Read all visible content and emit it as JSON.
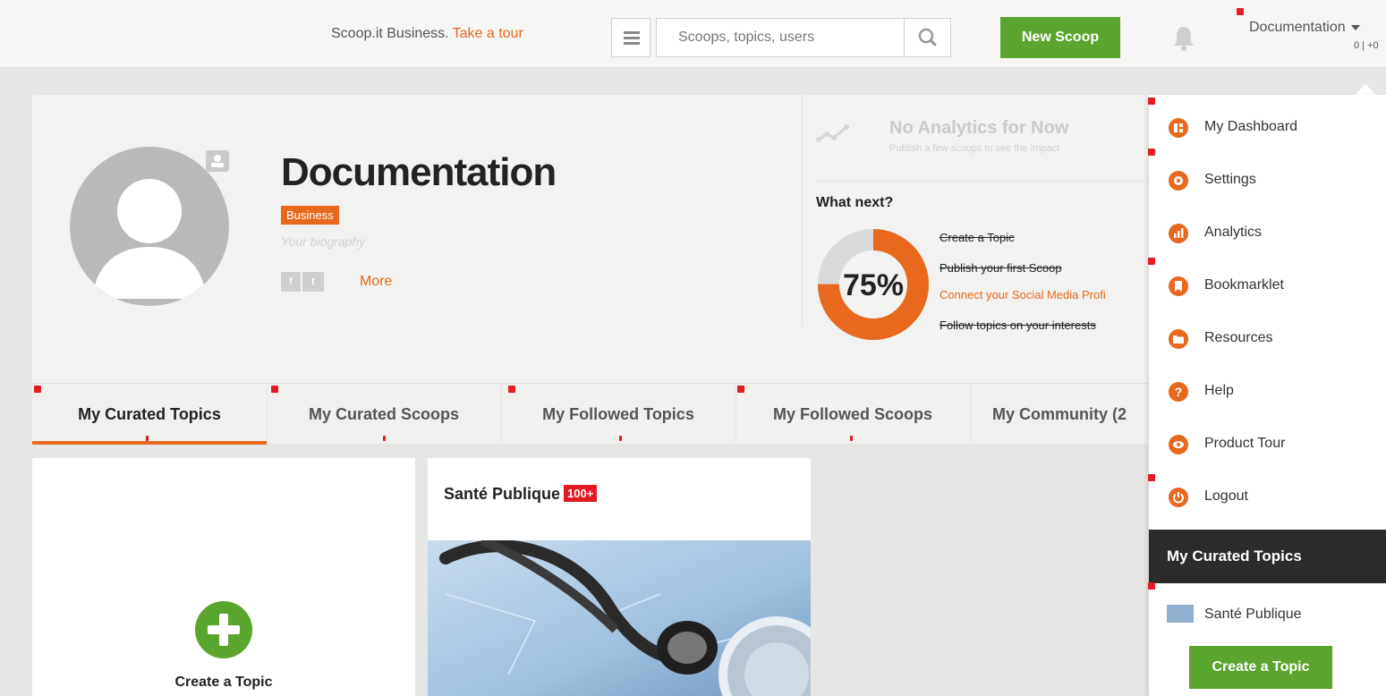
{
  "topbar": {
    "promo_text": "Scoop.it Business.",
    "tour_link": "Take a tour",
    "search_placeholder": "Scoops, topics, users",
    "new_scoop": "New Scoop",
    "account_name": "Documentation",
    "account_count": "0 | +0"
  },
  "profile": {
    "name": "Documentation",
    "badge": "Business",
    "bio_placeholder": "Your biography",
    "social": [
      "f",
      "t"
    ],
    "more": "More"
  },
  "analytics": {
    "title": "No Analytics for Now",
    "text": "Publish a few scoops to see the impact"
  },
  "what_next": {
    "title": "What next?",
    "percent": "75%",
    "progress": 0.75,
    "items": [
      {
        "label": "Create a Topic",
        "done": true
      },
      {
        "label": "Publish your first Scoop",
        "done": true
      },
      {
        "label": "Connect your Social Media Profi",
        "done": false
      },
      {
        "label": "Follow topics on your interests",
        "done": true
      }
    ]
  },
  "tabs": [
    {
      "label": "My Curated Topics",
      "active": true
    },
    {
      "label": "My Curated Scoops",
      "active": false
    },
    {
      "label": "My Followed Topics",
      "active": false
    },
    {
      "label": "My Followed Scoops",
      "active": false
    },
    {
      "label": "My Community (2",
      "active": false
    }
  ],
  "create_card": {
    "label": "Create a Topic"
  },
  "topic_card": {
    "title": "Santé Publique",
    "count": "100+"
  },
  "dropdown": {
    "items": [
      {
        "label": "My Dashboard",
        "icon": "dashboard-icon"
      },
      {
        "label": "Settings",
        "icon": "gear-icon"
      },
      {
        "label": "Analytics",
        "icon": "analytics-icon"
      },
      {
        "label": "Bookmarklet",
        "icon": "bookmark-icon"
      },
      {
        "label": "Resources",
        "icon": "folder-icon"
      },
      {
        "label": "Help",
        "icon": "help-icon"
      },
      {
        "label": "Product Tour",
        "icon": "eye-icon"
      },
      {
        "label": "Logout",
        "icon": "power-icon"
      }
    ],
    "section_title": "My Curated Topics",
    "topic": "Santé Publique",
    "create_button": "Create a Topic"
  },
  "colors": {
    "accent": "#e8681d",
    "green": "#5aa52e",
    "dark": "#2b2b2b",
    "red": "#e31b23"
  }
}
